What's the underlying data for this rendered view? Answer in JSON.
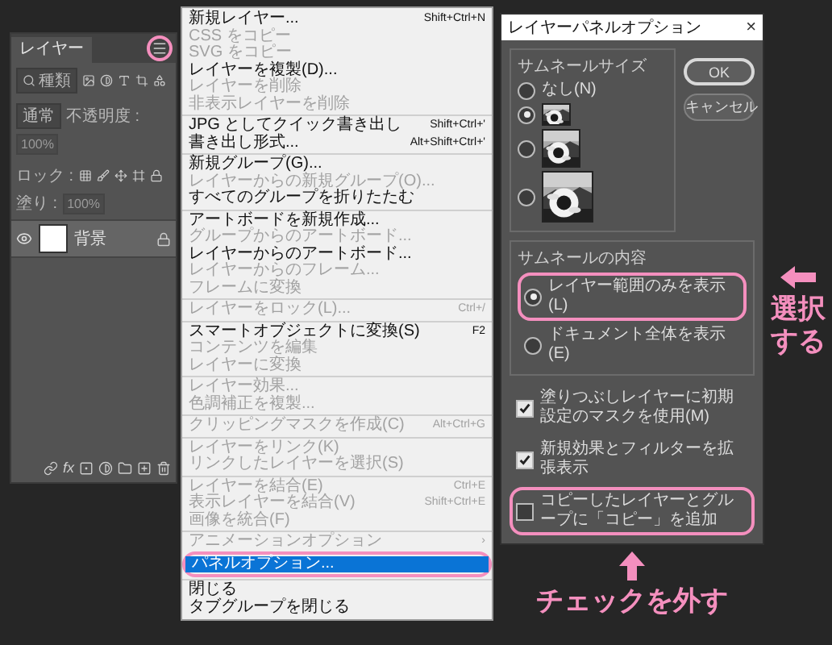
{
  "layers_panel": {
    "tab": "レイヤー",
    "tab_selected": true,
    "menu_button_circled": true,
    "filter": {
      "value": "種類"
    },
    "blend_mode": "通常",
    "opacity_label": "不透明度 :",
    "opacity": "100%",
    "lock_label": "ロック :",
    "fill_label": "塗り :",
    "fill": "100%",
    "layers": [
      {
        "name": "背景",
        "visible": true,
        "locked": true,
        "selected": true
      }
    ],
    "effects_button": "fx"
  },
  "panel_menu": {
    "groups": [
      [
        {
          "label": "新規レイヤー...",
          "shortcut": "Shift+Ctrl+N",
          "disabled": false,
          "selected": false,
          "circled": false
        },
        {
          "label": "CSS をコピー",
          "disabled": true,
          "selected": false,
          "circled": false
        },
        {
          "label": "SVG をコピー",
          "disabled": true,
          "selected": false,
          "circled": false
        },
        {
          "label": "レイヤーを複製(D)...",
          "disabled": false,
          "selected": false,
          "circled": false
        },
        {
          "label": "レイヤーを削除",
          "disabled": true,
          "selected": false,
          "circled": false
        },
        {
          "label": "非表示レイヤーを削除",
          "disabled": true,
          "selected": false,
          "circled": false
        }
      ],
      [
        {
          "label": "JPG としてクイック書き出し",
          "shortcut": "Shift+Ctrl+'",
          "disabled": false,
          "selected": false,
          "circled": false
        },
        {
          "label": "書き出し形式...",
          "shortcut": "Alt+Shift+Ctrl+'",
          "disabled": false,
          "selected": false,
          "circled": false
        }
      ],
      [
        {
          "label": "新規グループ(G)...",
          "disabled": false,
          "selected": false,
          "circled": false
        },
        {
          "label": "レイヤーからの新規グループ(O)...",
          "disabled": true,
          "selected": false,
          "circled": false
        },
        {
          "label": "すべてのグループを折りたたむ",
          "disabled": false,
          "selected": false,
          "circled": false
        }
      ],
      [
        {
          "label": "アートボードを新規作成...",
          "disabled": false,
          "selected": false,
          "circled": false
        },
        {
          "label": "グループからのアートボード...",
          "disabled": true,
          "selected": false,
          "circled": false
        },
        {
          "label": "レイヤーからのアートボード...",
          "disabled": false,
          "selected": false,
          "circled": false
        },
        {
          "label": "レイヤーからのフレーム...",
          "disabled": true,
          "selected": false,
          "circled": false
        },
        {
          "label": "フレームに変換",
          "disabled": true,
          "selected": false,
          "circled": false
        }
      ],
      [
        {
          "label": "レイヤーをロック(L)...",
          "shortcut": "Ctrl+/",
          "disabled": true,
          "selected": false,
          "circled": false
        }
      ],
      [
        {
          "label": "スマートオブジェクトに変換(S)",
          "shortcut": "F2",
          "disabled": false,
          "selected": false,
          "circled": false
        },
        {
          "label": "コンテンツを編集",
          "disabled": true,
          "selected": false,
          "circled": false
        },
        {
          "label": "レイヤーに変換",
          "disabled": true,
          "selected": false,
          "circled": false
        }
      ],
      [
        {
          "label": "レイヤー効果...",
          "disabled": true,
          "selected": false,
          "circled": false
        },
        {
          "label": "色調補正を複製...",
          "disabled": true,
          "selected": false,
          "circled": false
        }
      ],
      [
        {
          "label": "クリッピングマスクを作成(C)",
          "shortcut": "Alt+Ctrl+G",
          "disabled": true,
          "selected": false,
          "circled": false
        }
      ],
      [
        {
          "label": "レイヤーをリンク(K)",
          "disabled": true,
          "selected": false,
          "circled": false
        },
        {
          "label": "リンクしたレイヤーを選択(S)",
          "disabled": true,
          "selected": false,
          "circled": false
        }
      ],
      [
        {
          "label": "レイヤーを結合(E)",
          "shortcut": "Ctrl+E",
          "disabled": true,
          "selected": false,
          "circled": false
        },
        {
          "label": "表示レイヤーを結合(V)",
          "shortcut": "Shift+Ctrl+E",
          "disabled": true,
          "selected": false,
          "circled": false
        },
        {
          "label": "画像を統合(F)",
          "disabled": true,
          "selected": false,
          "circled": false
        }
      ],
      [
        {
          "label": "アニメーションオプション",
          "shortcut": "›",
          "disabled": true,
          "selected": false,
          "circled": false
        },
        {
          "label": "パネルオプション...",
          "disabled": false,
          "selected": true,
          "circled": true
        }
      ],
      [
        {
          "label": "閉じる",
          "disabled": false,
          "selected": false,
          "circled": false
        },
        {
          "label": "タブグループを閉じる",
          "disabled": false,
          "selected": false,
          "circled": false
        }
      ]
    ]
  },
  "dialog": {
    "title": "レイヤーパネルオプション",
    "close": "×",
    "thumbnail_size": {
      "label": "サムネールサイズ",
      "options": [
        {
          "kind": "none",
          "label": "なし(N)",
          "selected": false
        },
        {
          "kind": "small",
          "selected": true
        },
        {
          "kind": "medium",
          "selected": false
        },
        {
          "kind": "large",
          "selected": false
        }
      ]
    },
    "thumbnail_contents": {
      "label": "サムネールの内容",
      "options": [
        {
          "label": "レイヤー範囲のみを表示(L)",
          "selected": true,
          "circled": true
        },
        {
          "label": "ドキュメント全体を表示(E)",
          "selected": false,
          "circled": false
        }
      ]
    },
    "checkboxes": [
      {
        "label": "塗りつぶしレイヤーに初期設定のマスクを使用(M)",
        "checked": true,
        "circled": false
      },
      {
        "label": "新規効果とフィルターを拡張表示",
        "checked": true,
        "circled": false
      },
      {
        "label": "コピーしたレイヤーとグループに「コピー」を追加",
        "checked": false,
        "circled": true
      }
    ],
    "buttons": [
      {
        "label": "OK",
        "default": true
      },
      {
        "label": "キャンセル",
        "default": false
      }
    ]
  },
  "annotations": {
    "select_note": "選択する",
    "uncheck_note": "チェックを外す"
  }
}
